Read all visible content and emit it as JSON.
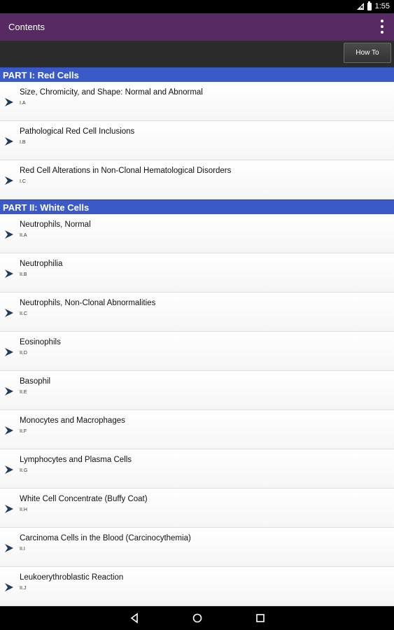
{
  "status_bar": {
    "time": "1:55"
  },
  "app_bar": {
    "title": "Contents"
  },
  "toolbar": {
    "how_to_label": "How To"
  },
  "sections": [
    {
      "title": "PART I: Red Cells",
      "items": [
        {
          "title": "Size, Chromicity, and Shape: Normal and Abnormal",
          "code": "I.A"
        },
        {
          "title": "Pathological Red Cell Inclusions",
          "code": "I.B"
        },
        {
          "title": "Red Cell Alterations in Non-Clonal Hematological Disorders",
          "code": "I.C"
        }
      ]
    },
    {
      "title": "PART II: White Cells",
      "items": [
        {
          "title": "Neutrophils, Normal",
          "code": "II.A"
        },
        {
          "title": "Neutrophilia",
          "code": "II.B"
        },
        {
          "title": "Neutrophils, Non-Clonal Abnormalities",
          "code": "II.C"
        },
        {
          "title": "Eosinophils",
          "code": "II.D"
        },
        {
          "title": "Basophil",
          "code": "II.E"
        },
        {
          "title": "Monocytes and Macrophages",
          "code": "II.F"
        },
        {
          "title": "Lymphocytes and Plasma Cells",
          "code": "II.G"
        },
        {
          "title": "White Cell Concentrate (Buffy Coat)",
          "code": "II.H"
        },
        {
          "title": "Carcinoma Cells in the Blood (Carcinocythemia)",
          "code": "II.I"
        },
        {
          "title": "Leukoerythroblastic Reaction",
          "code": "II.J"
        }
      ]
    }
  ],
  "colors": {
    "app_bar": "#582a64",
    "section_header": "#3a5bc7",
    "chevron": "#1f3b5c"
  }
}
